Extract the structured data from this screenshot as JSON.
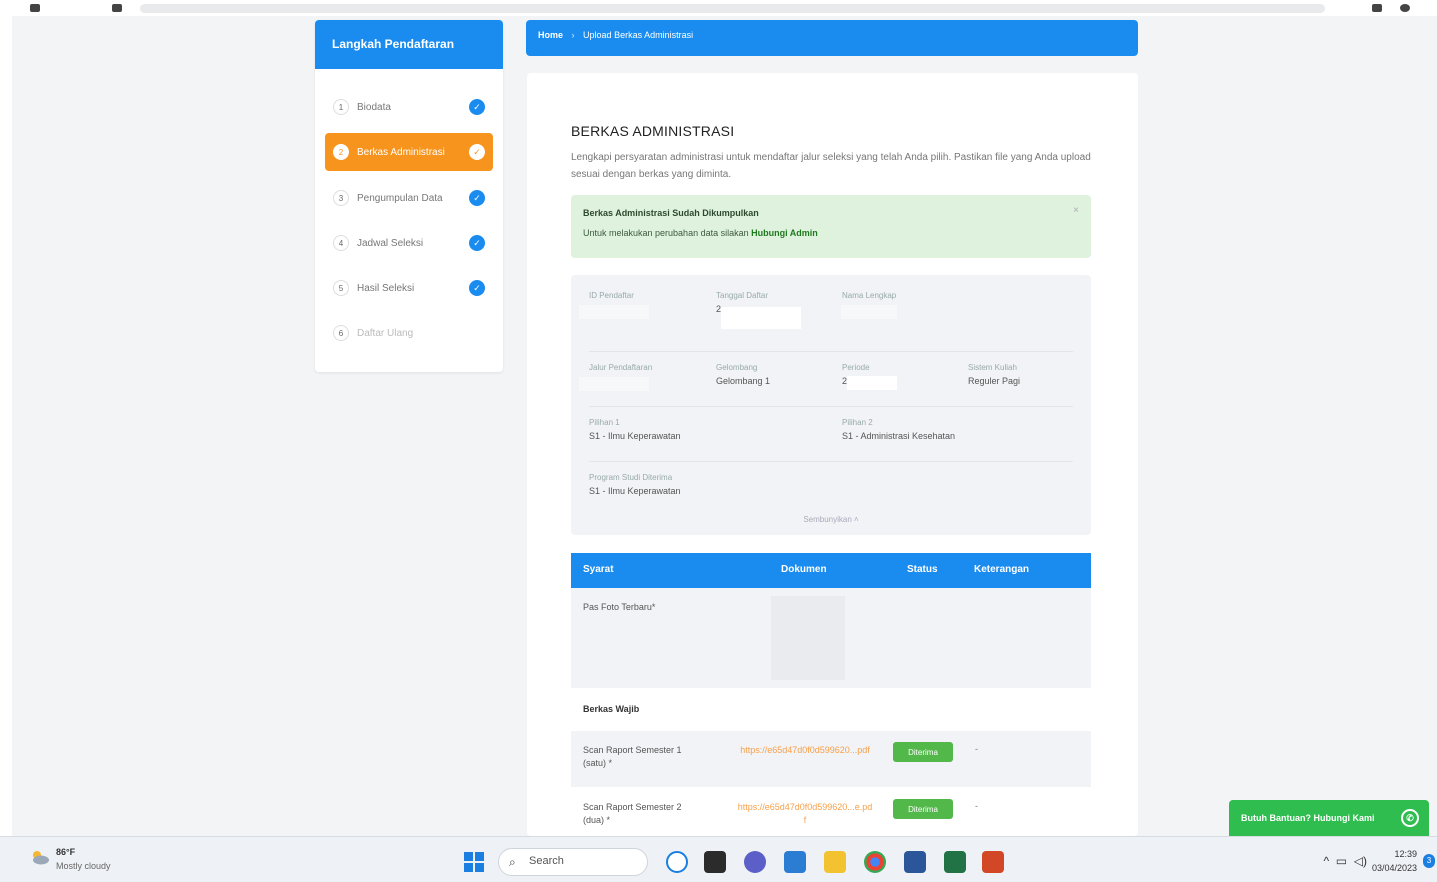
{
  "sidebar": {
    "title": "Langkah Pendaftaran",
    "steps": [
      {
        "num": "1",
        "label": "Biodata",
        "done": true
      },
      {
        "num": "2",
        "label": "Berkas Administrasi",
        "done": true
      },
      {
        "num": "3",
        "label": "Pengumpulan Data",
        "done": true
      },
      {
        "num": "4",
        "label": "Jadwal Seleksi",
        "done": true
      },
      {
        "num": "5",
        "label": "Hasil Seleksi",
        "done": true
      },
      {
        "num": "6",
        "label": "Daftar Ulang",
        "done": false
      }
    ]
  },
  "breadcrumb": {
    "home": "Home",
    "separator": "›",
    "current": "Upload Berkas Administrasi"
  },
  "main": {
    "title": "BERKAS ADMINISTRASI",
    "intro": "Lengkapi persyaratan administrasi untuk mendaftar jalur seleksi yang telah Anda pilih. Pastikan file yang Anda upload sesuai dengan berkas yang diminta.",
    "alert": {
      "title": "Berkas Administrasi Sudah Dikumpulkan",
      "text": "Untuk melakukan perubahan data silakan ",
      "link": "Hubungi Admin",
      "close": "×"
    },
    "info": {
      "id_label": "ID Pendaftar",
      "tanggal_label": "Tanggal Daftar",
      "tanggal_value": "2",
      "nama_label": "Nama Lengkap",
      "jalur_label": "Jalur Pendaftaran",
      "gelombang_label": "Gelombang",
      "gelombang_value": "Gelombang 1",
      "periode_label": "Periode",
      "periode_value": "2",
      "sistem_label": "Sistem Kuliah",
      "sistem_value": "Reguler Pagi",
      "pilihan1_label": "Pilihan 1",
      "pilihan1_value": "S1 - Ilmu Keperawatan",
      "pilihan2_label": "Pilihan 2",
      "pilihan2_value": "S1 - Administrasi Kesehatan",
      "diterima_label": "Program Studi Diterima",
      "diterima_value": "S1 - Ilmu Keperawatan",
      "toggle": "Sembunyikan ˄"
    },
    "table": {
      "headers": [
        "Syarat",
        "Dokumen",
        "Status",
        "Keterangan"
      ],
      "photo_row": "Pas Foto Terbaru*",
      "section": "Berkas Wajib",
      "rows": [
        {
          "syarat": "Scan Raport Semester 1 (satu) *",
          "dokumen": "https://e65d47d0f0d599620...pdf",
          "status": "Diterima",
          "keterangan": "-"
        },
        {
          "syarat": "Scan Raport Semester 2 (dua) *",
          "dokumen": "https://e65d47d0f0d599620...e.pdf",
          "status": "Diterima",
          "keterangan": "-"
        }
      ]
    }
  },
  "whatsapp": {
    "label": "Butuh Bantuan? Hubungi Kami"
  },
  "taskbar": {
    "weather_temp": "86°F",
    "weather_cond": "Mostly cloudy",
    "search_placeholder": "Search",
    "time": "12:39",
    "date": "03/04/2023",
    "notifications": "3"
  },
  "colors": {
    "primary": "#1a8cf0",
    "active_step": "#f7941d",
    "success": "#52b84a",
    "alert_bg": "#dff2de",
    "whatsapp": "#2ebd4e"
  }
}
